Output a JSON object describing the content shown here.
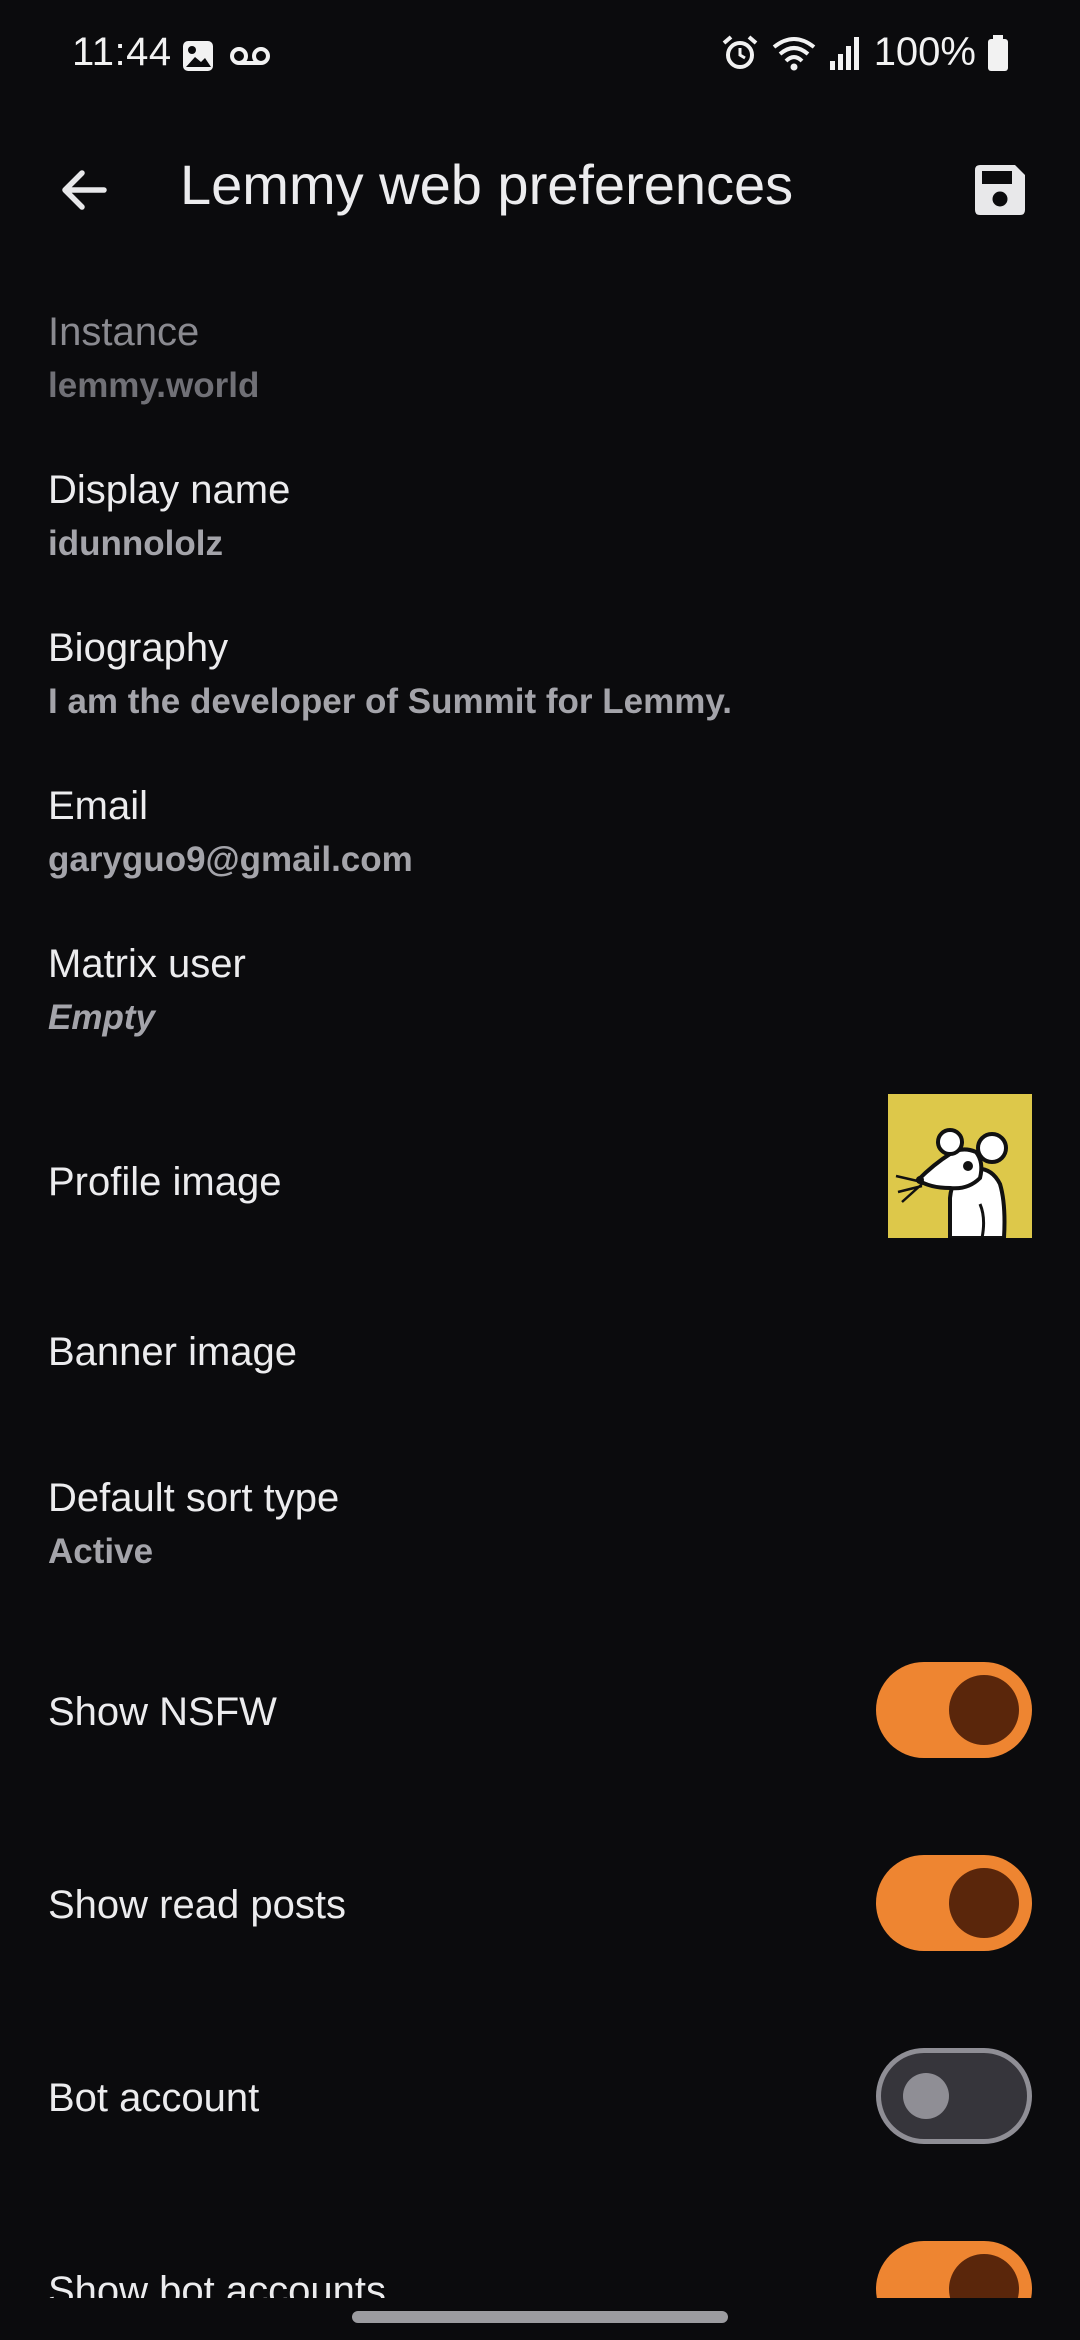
{
  "status_bar": {
    "time": "11:44",
    "battery": "100%",
    "icons": [
      "gallery-icon",
      "voicemail-icon",
      "alarm-icon",
      "wifi-icon",
      "signal-icon",
      "battery-icon"
    ]
  },
  "app_bar": {
    "title": "Lemmy web preferences",
    "back_icon": "arrow-left-icon",
    "save_icon": "save-icon"
  },
  "settings": {
    "instance": {
      "title": "Instance",
      "value": "lemmy.world"
    },
    "display_name": {
      "title": "Display name",
      "value": "idunnololz"
    },
    "biography": {
      "title": "Biography",
      "value": "I am the developer of Summit for Lemmy."
    },
    "email": {
      "title": "Email",
      "value": "garyguo9@gmail.com"
    },
    "matrix_user": {
      "title": "Matrix user",
      "value": "Empty"
    },
    "profile_image": {
      "title": "Profile image"
    },
    "banner_image": {
      "title": "Banner image"
    },
    "default_sort": {
      "title": "Default sort type",
      "value": "Active"
    },
    "show_nsfw": {
      "title": "Show NSFW",
      "on": true
    },
    "show_read_posts": {
      "title": "Show read posts",
      "on": true
    },
    "bot_account": {
      "title": "Bot account",
      "on": false
    },
    "show_bot_accounts": {
      "title": "Show bot accounts",
      "on": true
    }
  },
  "colors": {
    "background": "#0b0b0d",
    "accent": "#ee8531",
    "switch_thumb_on": "#5a260b",
    "avatar_bg": "#ddc84a"
  }
}
